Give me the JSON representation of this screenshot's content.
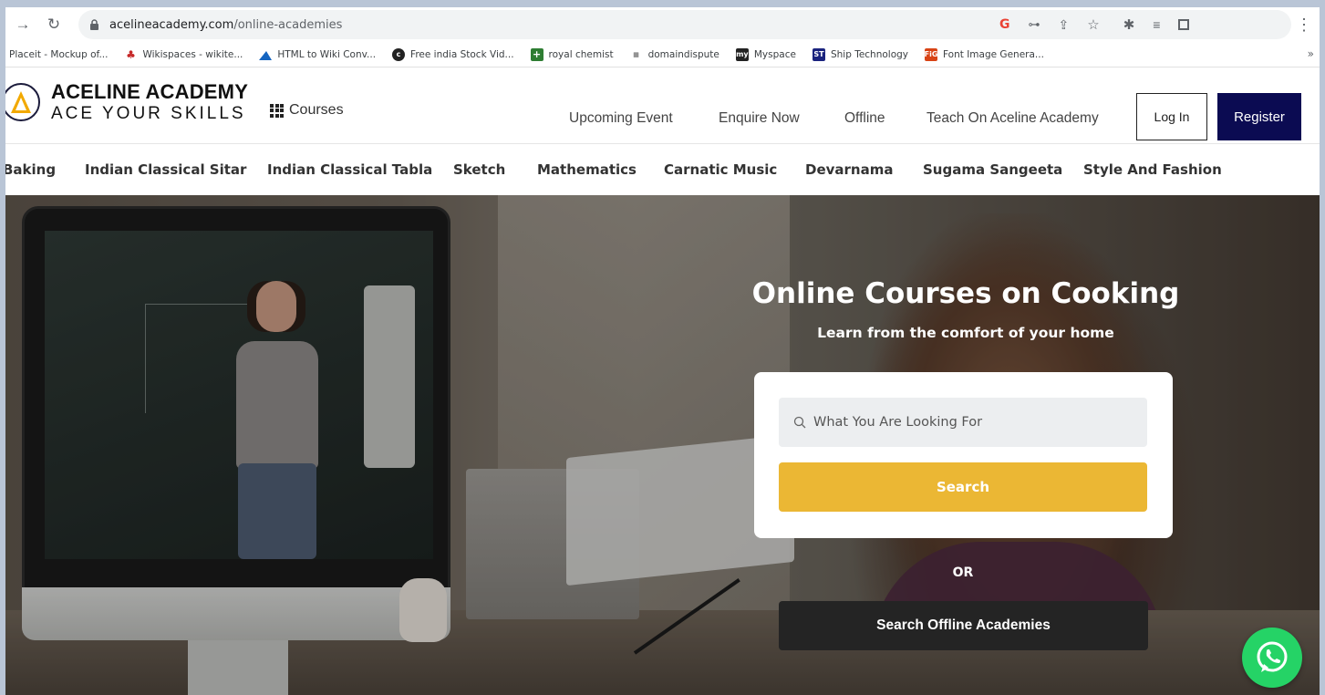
{
  "browser": {
    "back_icon": "arrow-right-icon",
    "reload_icon": "reload-icon",
    "url_host": "acelineacademy.com",
    "url_path": "/online-academies",
    "omnibox_icons": [
      "google-icon",
      "key-icon",
      "share-icon",
      "star-icon"
    ],
    "extension_icons": [
      "puzzle-icon",
      "playlist-icon",
      "sidepanel-icon"
    ],
    "menu_icon": "kebab-icon",
    "bookmarks": [
      {
        "label": "Placeit - Mockup of...",
        "icon": "none",
        "color": "#ffffff"
      },
      {
        "label": "Wikispaces - wikite...",
        "icon": "plant-icon",
        "color": "#2e7d32"
      },
      {
        "label": "HTML to Wiki Conv...",
        "icon": "chart-icon",
        "color": "#1565c0"
      },
      {
        "label": "Free india Stock Vid...",
        "icon": "circle-icon",
        "color": "#222222"
      },
      {
        "label": "royal chemist",
        "icon": "cross-icon",
        "color": "#2e7d32"
      },
      {
        "label": "domaindispute",
        "icon": "text-icon",
        "color": "#555555"
      },
      {
        "label": "Myspace",
        "icon": "my-icon",
        "color": "#222222"
      },
      {
        "label": "Ship Technology",
        "icon": "st-icon",
        "color": "#1a237e"
      },
      {
        "label": "Font Image Genera...",
        "icon": "fig-icon",
        "color": "#d84315"
      }
    ],
    "bookmarks_more": "»"
  },
  "header": {
    "logo_title": "ACELINE ACADEMY",
    "logo_tagline": "ACE YOUR SKILLS",
    "courses_label": "Courses",
    "nav": [
      "Upcoming Event",
      "Enquire Now",
      "Offline",
      "Teach On Aceline Academy"
    ],
    "login_label": "Log In",
    "register_label": "Register",
    "brand_color": "#0b0b52"
  },
  "categories": [
    "Baking",
    "Indian Classical Sitar",
    "Indian Classical Tabla",
    "Sketch",
    "Mathematics",
    "Carnatic Music",
    "Devarnama",
    "Sugama Sangeeta",
    "Style And Fashion"
  ],
  "hero": {
    "title": "Online Courses on Cooking",
    "subtitle": "Learn from the comfort of your home",
    "search_placeholder": "What You Are Looking For",
    "search_button": "Search",
    "or_text": "OR",
    "offline_button": "Search Offline Academies",
    "accent_color": "#ebb734",
    "whatsapp_icon": "whatsapp-icon"
  }
}
